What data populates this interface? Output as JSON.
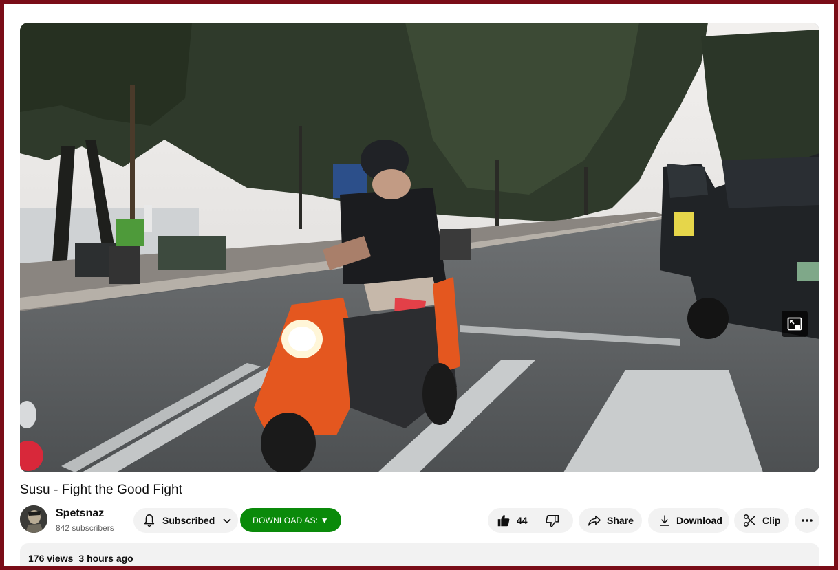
{
  "video": {
    "title": "Susu - Fight the Good Fight",
    "scene_icon": "miniplayer-icon"
  },
  "channel": {
    "name": "Spetsnaz",
    "subscribers": "842 subscribers"
  },
  "actions": {
    "subscribed_label": "Subscribed",
    "download_as_label": "DOWNLOAD AS: ▼",
    "likes": "44",
    "share_label": "Share",
    "download_label": "Download",
    "clip_label": "Clip"
  },
  "description": {
    "views": "176 views",
    "age": "3 hours ago"
  },
  "colors": {
    "frame": "#7a0d18",
    "download_as_bg": "#0a8a0a",
    "pill_bg": "#f2f2f2"
  }
}
